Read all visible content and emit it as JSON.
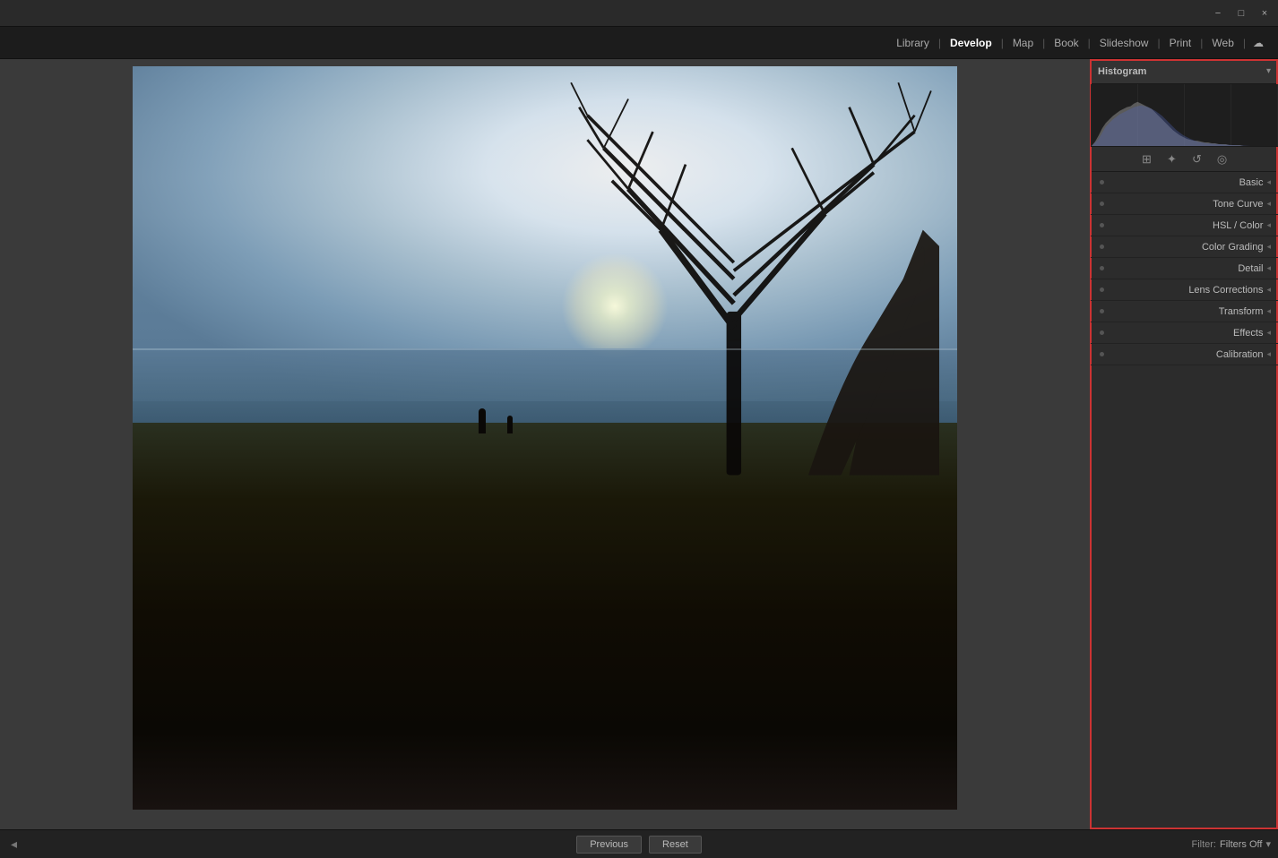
{
  "titlebar": {
    "minimize_label": "−",
    "maximize_label": "□",
    "close_label": "×"
  },
  "navbar": {
    "items": [
      {
        "id": "library",
        "label": "Library",
        "active": false
      },
      {
        "id": "develop",
        "label": "Develop",
        "active": true
      },
      {
        "id": "map",
        "label": "Map",
        "active": false
      },
      {
        "id": "book",
        "label": "Book",
        "active": false
      },
      {
        "id": "slideshow",
        "label": "Slideshow",
        "active": false
      },
      {
        "id": "print",
        "label": "Print",
        "active": false
      },
      {
        "id": "web",
        "label": "Web",
        "active": false
      }
    ]
  },
  "right_panel": {
    "histogram_title": "Histogram",
    "histogram_arrow": "▾",
    "tool_icons": [
      {
        "id": "crop-icon",
        "symbol": "⊞"
      },
      {
        "id": "heal-icon",
        "symbol": "✦"
      },
      {
        "id": "redeye-icon",
        "symbol": "↺"
      },
      {
        "id": "mask-icon",
        "symbol": "◎"
      }
    ],
    "sections": [
      {
        "id": "basic",
        "label": "Basic",
        "arrow": "◂"
      },
      {
        "id": "tone-curve",
        "label": "Tone Curve",
        "arrow": "◂"
      },
      {
        "id": "hsl-color",
        "label": "HSL / Color",
        "arrow": "◂"
      },
      {
        "id": "color-grading",
        "label": "Color Grading",
        "arrow": "◂"
      },
      {
        "id": "detail",
        "label": "Detail",
        "arrow": "◂"
      },
      {
        "id": "lens-corrections",
        "label": "Lens Corrections",
        "arrow": "◂"
      },
      {
        "id": "transform",
        "label": "Transform",
        "arrow": "◂"
      },
      {
        "id": "effects",
        "label": "Effects",
        "arrow": "◂"
      },
      {
        "id": "calibration",
        "label": "Calibration",
        "arrow": "◂"
      }
    ]
  },
  "bottom_bar": {
    "previous_label": "Previous",
    "reset_label": "Reset",
    "filter_label": "Filter:",
    "filters_off_label": "Filters Off"
  }
}
